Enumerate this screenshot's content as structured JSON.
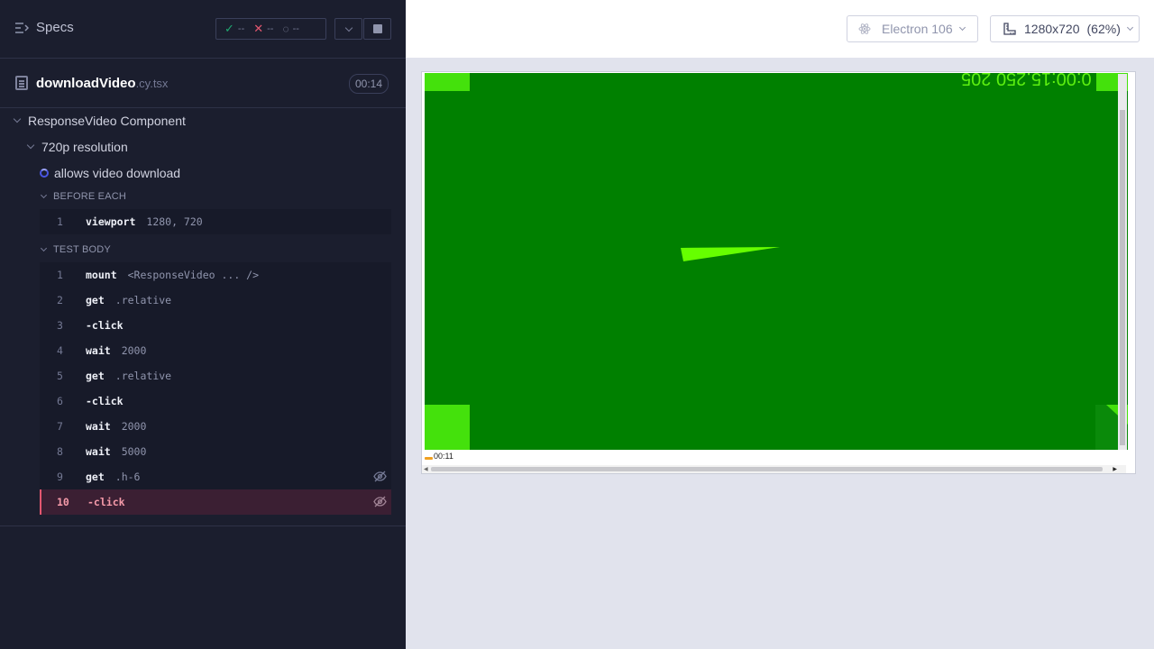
{
  "reporter": {
    "specs_label": "Specs",
    "stats": {
      "passed": "--",
      "failed": "--",
      "pending": "--"
    },
    "file": {
      "name": "downloadVideo",
      "ext": ".cy.tsx",
      "duration": "00:14"
    },
    "suite": "ResponseVideo Component",
    "subsuite": "720p resolution",
    "test": "allows video download",
    "before_each_label": "BEFORE EACH",
    "test_body_label": "TEST BODY",
    "before_each": [
      {
        "num": "1",
        "name": "viewport",
        "msg": "1280, 720"
      }
    ],
    "body": [
      {
        "num": "1",
        "name": "mount",
        "msg": "<ResponseVideo ... />"
      },
      {
        "num": "2",
        "name": "get",
        "msg": ".relative"
      },
      {
        "num": "3",
        "name": "-click",
        "msg": ""
      },
      {
        "num": "4",
        "name": "wait",
        "msg": "2000"
      },
      {
        "num": "5",
        "name": "get",
        "msg": ".relative"
      },
      {
        "num": "6",
        "name": "-click",
        "msg": ""
      },
      {
        "num": "7",
        "name": "wait",
        "msg": "2000"
      },
      {
        "num": "8",
        "name": "wait",
        "msg": "5000"
      },
      {
        "num": "9",
        "name": "get",
        "msg": ".h-6"
      },
      {
        "num": "10",
        "name": "-click",
        "msg": ""
      }
    ]
  },
  "aut": {
    "browser": "Electron 106",
    "viewport": "1280x720",
    "scale": "(62%)",
    "video_timestamp": "0:00:15.250 205",
    "video_time": "00:11"
  },
  "colors": {
    "accent": "#4956e3",
    "pass": "#1fa971",
    "fail": "#e45770",
    "video_bg": "#008000",
    "video_marker": "#44e10c"
  }
}
